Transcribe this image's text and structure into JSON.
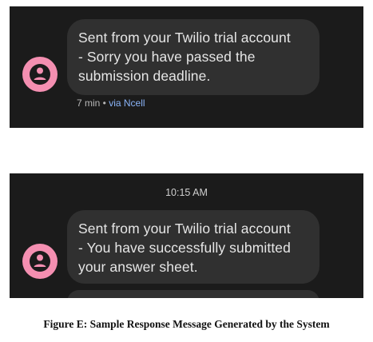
{
  "screenshot_1": {
    "message": {
      "lines": [
        "Sent from your Twilio trial account",
        "- Sorry you have passed the",
        "submission deadline."
      ]
    },
    "meta": {
      "time": "7 min",
      "separator": " • ",
      "carrier": "via Ncell"
    },
    "avatar_icon": "person-icon",
    "avatar_color": "#f48fb1"
  },
  "screenshot_2": {
    "timestamp": "10:15 AM",
    "message": {
      "lines": [
        "Sent from your Twilio trial account",
        "- You have successfully submitted",
        "your answer sheet."
      ]
    },
    "avatar_icon": "person-icon",
    "avatar_color": "#f48fb1"
  },
  "caption": "Figure E: Sample Response Message Generated by the System",
  "colors": {
    "background": "#1b1b1b",
    "bubble": "#303030",
    "text": "#e6e6e6",
    "link": "#8ab4f8"
  }
}
